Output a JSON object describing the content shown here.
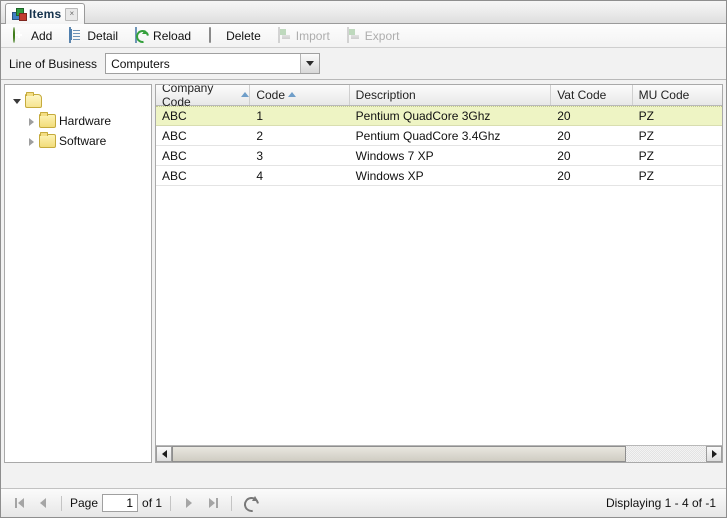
{
  "tab": {
    "title": "Items",
    "icon": "items-icon",
    "close_label": "×"
  },
  "toolbar": {
    "buttons": [
      {
        "label": "Add",
        "icon": "add-icon",
        "disabled": false
      },
      {
        "label": "Detail",
        "icon": "detail-icon",
        "disabled": false
      },
      {
        "label": "Reload",
        "icon": "reload-icon",
        "disabled": false
      },
      {
        "label": "Delete",
        "icon": "delete-icon",
        "disabled": false
      },
      {
        "label": "Import",
        "icon": "import-icon",
        "disabled": true
      },
      {
        "label": "Export",
        "icon": "export-icon",
        "disabled": true
      }
    ]
  },
  "filter": {
    "label": "Line of Business",
    "combo_value": "Computers",
    "combo_placeholder": "",
    "arrow_icon": "chevron-down-icon"
  },
  "tree": {
    "root": {
      "label": "",
      "icon": "folder-icon",
      "expanded": true
    },
    "items": [
      {
        "label": "Hardware",
        "icon": "folder-icon",
        "expanded": false
      },
      {
        "label": "Software",
        "icon": "folder-icon",
        "expanded": false
      }
    ]
  },
  "grid": {
    "columns": [
      {
        "label": "Company Code",
        "sort": "asc"
      },
      {
        "label": "Code",
        "sort": "asc"
      },
      {
        "label": "Description",
        "sort": "none"
      },
      {
        "label": "Vat Code",
        "sort": "none"
      },
      {
        "label": "MU Code",
        "sort": "none"
      }
    ],
    "rows": [
      {
        "cells": [
          "ABC",
          "1",
          "Pentium QuadCore 3Ghz",
          "20",
          "PZ"
        ],
        "selected": true
      },
      {
        "cells": [
          "ABC",
          "2",
          "Pentium QuadCore 3.4Ghz",
          "20",
          "PZ"
        ],
        "selected": false
      },
      {
        "cells": [
          "ABC",
          "3",
          "Windows 7 XP",
          "20",
          "PZ"
        ],
        "selected": false
      },
      {
        "cells": [
          "ABC",
          "4",
          "Windows XP",
          "20",
          "PZ"
        ],
        "selected": false
      }
    ],
    "hscroll": {
      "left_icon": "arrow-left-icon",
      "right_icon": "arrow-right-icon",
      "thumb_percent": 85
    }
  },
  "pager": {
    "first_icon": "first-page-icon",
    "prev_icon": "previous-page-icon",
    "next_icon": "next-page-icon",
    "last_icon": "last-page-icon",
    "refresh_icon": "refresh-icon",
    "page_label": "Page",
    "page_value": "1",
    "of_label": "of 1",
    "status": "Displaying 1 - 4 of -1"
  },
  "colors": {
    "selected_row": "#eef4c4",
    "sort_arrow": "#6f9ec9",
    "folder": "#f2dc7a",
    "add_green": "#63b02f"
  }
}
